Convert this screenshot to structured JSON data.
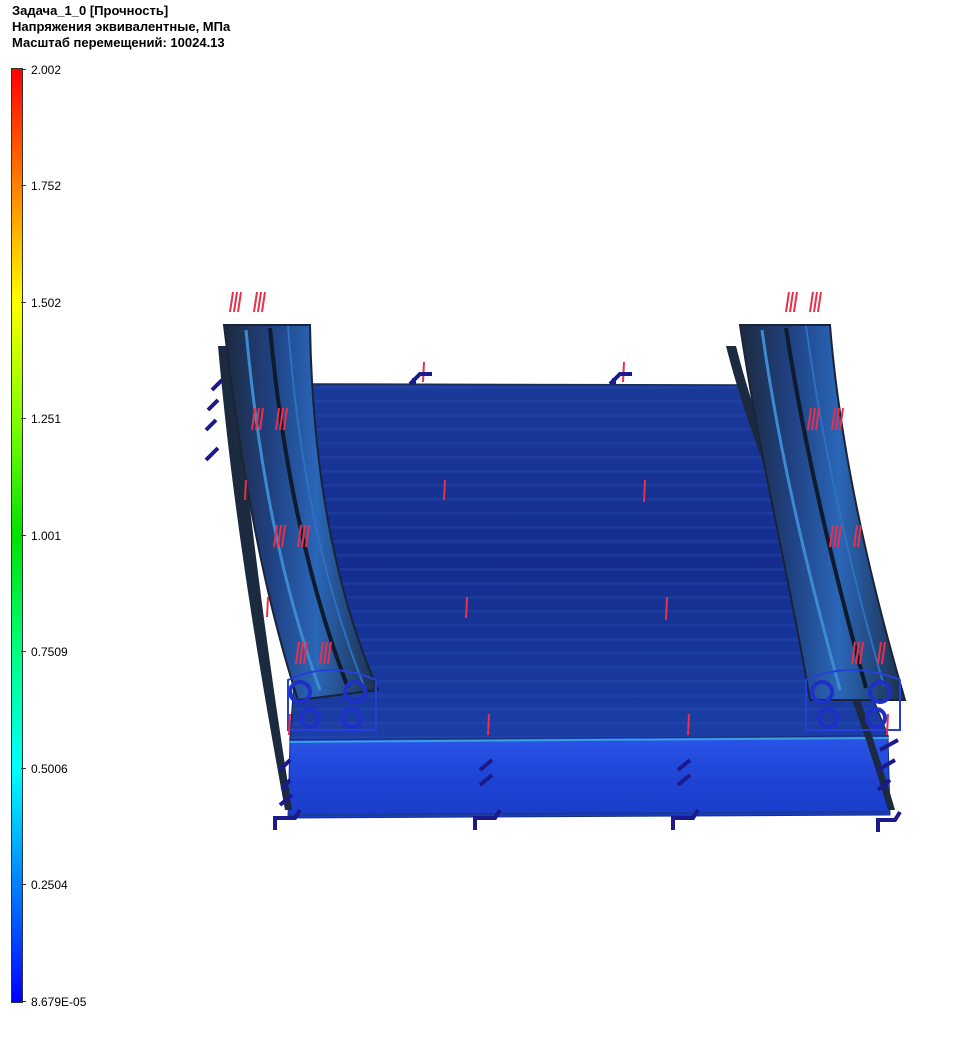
{
  "header": {
    "title": "Задача_1_0 [Прочность]",
    "result": "Напряжения эквивалентные, МПа",
    "scale": "Масштаб перемещений: 10024.13"
  },
  "legend": {
    "ticks": [
      "2.002",
      "1.752",
      "1.502",
      "1.251",
      "1.001",
      "0.7509",
      "0.5006",
      "0.2504",
      "8.679E-05"
    ]
  },
  "colors": {
    "max": "#ff0000",
    "min": "#0000ff",
    "model_plate": "#1631a8",
    "model_edge": "#1c2f4a",
    "load_marker": "#e8304a",
    "support_marker": "#1a1a8c"
  }
}
